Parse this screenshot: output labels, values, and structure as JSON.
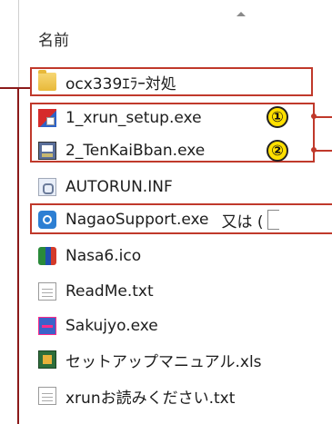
{
  "header": {
    "column_name": "名前"
  },
  "files": [
    {
      "name": "ocx339ｴﾗｰ対処",
      "icon": "folder-icon"
    },
    {
      "name": "1_xrun_setup.exe",
      "icon": "setup-installer-icon",
      "annotation": "①"
    },
    {
      "name": "2_TenKaiBban.exe",
      "icon": "installer-program-icon",
      "annotation": "②"
    },
    {
      "name": "AUTORUN.INF",
      "icon": "inf-config-icon"
    },
    {
      "name": "NagaoSupport.exe",
      "icon": "nagao-support-icon",
      "extra_text": "又は ("
    },
    {
      "name": "Nasa6.ico",
      "icon": "nasa-ico-icon"
    },
    {
      "name": "ReadMe.txt",
      "icon": "text-document-icon"
    },
    {
      "name": "Sakujyo.exe",
      "icon": "sakujyo-app-icon"
    },
    {
      "name": "セットアップマニュアル.xls",
      "icon": "excel-icon"
    },
    {
      "name": "xrunお読みください.txt",
      "icon": "text-document-icon"
    }
  ],
  "colors": {
    "annotation_frame": "#c0392b",
    "annotation_badge": "#ffe000"
  }
}
